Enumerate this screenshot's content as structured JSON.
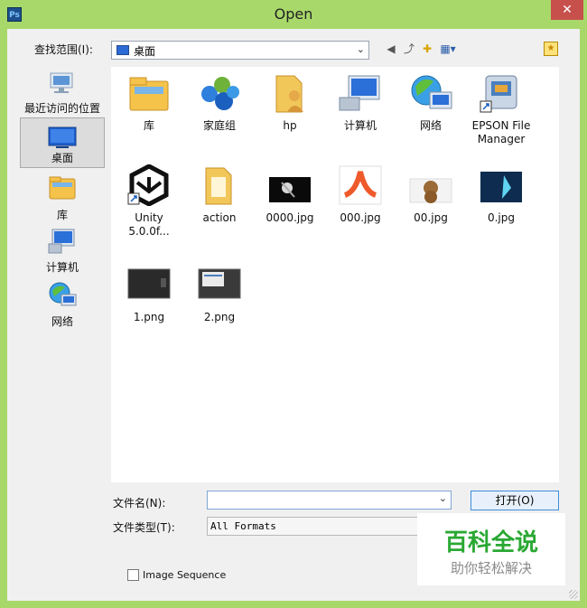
{
  "window": {
    "app_icon": "Ps",
    "title": "Open",
    "close_glyph": "✕"
  },
  "toolbar": {
    "look_in_label": "查找范围(I):",
    "look_in_value": "桌面",
    "chevron": "⌄",
    "back_glyph": "◀",
    "up_glyph": "⤴",
    "newfolder_glyph": "✚",
    "view_glyph": "▦▾",
    "bookmark_glyph": "★"
  },
  "places": [
    "最近访问的位置",
    "桌面",
    "库",
    "计算机",
    "网络"
  ],
  "files": [
    {
      "name": "库",
      "icon": "library-icon"
    },
    {
      "name": "家庭组",
      "icon": "homegroup-icon"
    },
    {
      "name": "hp",
      "icon": "user-folder-icon"
    },
    {
      "name": "计算机",
      "icon": "computer-icon"
    },
    {
      "name": "网络",
      "icon": "network-icon"
    },
    {
      "name": "EPSON File Manager",
      "icon": "epson-shortcut-icon"
    },
    {
      "name": "Unity 5.0.0f...",
      "icon": "unity-shortcut-icon"
    },
    {
      "name": "action",
      "icon": "folder-icon"
    },
    {
      "name": "0000.jpg",
      "icon": "image-thumb"
    },
    {
      "name": "000.jpg",
      "icon": "image-thumb"
    },
    {
      "name": "00.jpg",
      "icon": "image-thumb"
    },
    {
      "name": "0.jpg",
      "icon": "image-thumb"
    },
    {
      "name": "1.png",
      "icon": "image-thumb"
    },
    {
      "name": "2.png",
      "icon": "image-thumb"
    }
  ],
  "form": {
    "filename_label": "文件名(N):",
    "filename_value": "",
    "filetype_label": "文件类型(T):",
    "filetype_value": "All Formats",
    "open_label": "打开(O)",
    "image_sequence_label": "Image Sequence"
  },
  "watermark": {
    "big": "百科全说",
    "small": "助你轻松解决"
  },
  "colors": {
    "frame": "#a8d86a",
    "close": "#c7504c",
    "accent": "#3c8ddc",
    "watermark_green": "#2aa833"
  }
}
